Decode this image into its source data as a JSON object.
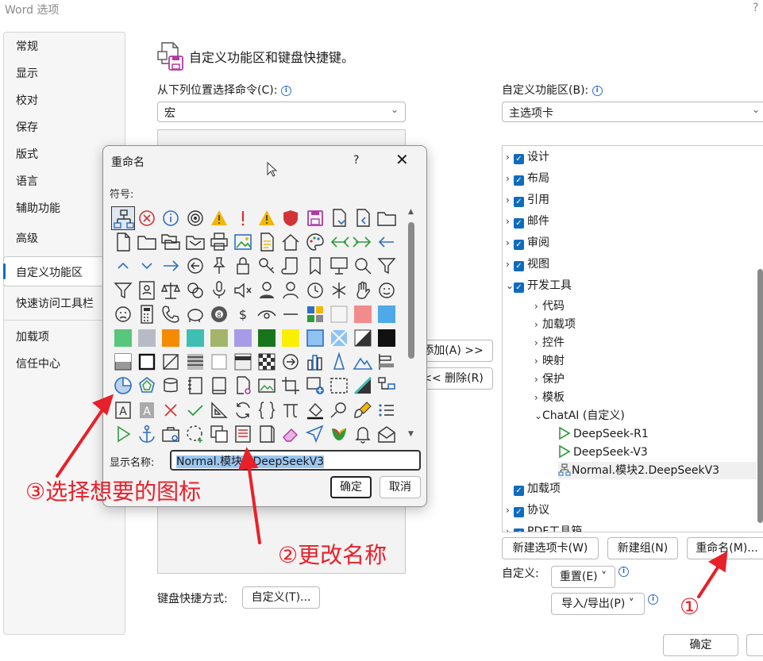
{
  "window": {
    "title": "Word 选项",
    "help": "?"
  },
  "nav": {
    "items": [
      "常规",
      "显示",
      "校对",
      "保存",
      "版式",
      "语言",
      "辅助功能",
      "高级",
      "自定义功能区",
      "快速访问工具栏",
      "加载项",
      "信任中心"
    ],
    "selected": "自定义功能区"
  },
  "header": {
    "title": "自定义功能区和键盘快捷键。"
  },
  "left": {
    "choose_label": "从下列位置选择命令(C):",
    "choose_value": "宏",
    "add_button": "添加(A) >>",
    "remove_button": "<< 删除(R)",
    "keyboard_label": "键盘快捷方式:",
    "keyboard_button": "自定义(T)..."
  },
  "right": {
    "ribbon_label": "自定义功能区(B):",
    "ribbon_value": "主选项卡",
    "tree": [
      {
        "label": "设计",
        "level": 0,
        "checked": true,
        "expanded": false
      },
      {
        "label": "布局",
        "level": 0,
        "checked": true,
        "expanded": false
      },
      {
        "label": "引用",
        "level": 0,
        "checked": true,
        "expanded": false
      },
      {
        "label": "邮件",
        "level": 0,
        "checked": true,
        "expanded": false
      },
      {
        "label": "审阅",
        "level": 0,
        "checked": true,
        "expanded": false
      },
      {
        "label": "视图",
        "level": 0,
        "checked": true,
        "expanded": false
      },
      {
        "label": "开发工具",
        "level": 0,
        "checked": true,
        "expanded": true
      },
      {
        "label": "代码",
        "level": 1
      },
      {
        "label": "加载项",
        "level": 1
      },
      {
        "label": "控件",
        "level": 1
      },
      {
        "label": "映射",
        "level": 1
      },
      {
        "label": "保护",
        "level": 1
      },
      {
        "label": "模板",
        "level": 1
      },
      {
        "label": "ChatAI (自定义)",
        "level": 1,
        "expanded": true
      },
      {
        "label": "DeepSeek-R1",
        "level": 2,
        "icon": "play-icon"
      },
      {
        "label": "DeepSeek-V3",
        "level": 2,
        "icon": "play-icon"
      },
      {
        "label": "Normal.模块2.DeepSeekV3",
        "level": 2,
        "icon": "org-chart-icon",
        "selected": true
      },
      {
        "label": "加载项",
        "level": 0,
        "checked": true,
        "noarrow": true
      },
      {
        "label": "协议",
        "level": 0,
        "checked": true,
        "expanded": false
      },
      {
        "label": "PDF工具箱",
        "level": 0,
        "checked": true,
        "expanded": false
      }
    ],
    "new_tab_button": "新建选项卡(W)",
    "new_group_button": "新建组(N)",
    "rename_button": "重命名(M)...",
    "customize_label": "自定义:",
    "reset_button": "重置(E) ˅",
    "import_export_button": "导入/导出(P) ˅"
  },
  "footer": {
    "ok_button": "确定"
  },
  "dialog": {
    "title": "重命名",
    "help": "?",
    "symbols_label": "符号:",
    "display_name_label": "显示名称:",
    "display_name_value": "Normal.模块2.DeepSeekV3",
    "ok_button": "确定",
    "cancel_button": "取消"
  },
  "annotations": {
    "step1": "①",
    "step2": "②更改名称",
    "step3": "③选择想要的图标"
  },
  "colors": {
    "accent": "#0f6cbd",
    "annotation": "#e8202a"
  }
}
